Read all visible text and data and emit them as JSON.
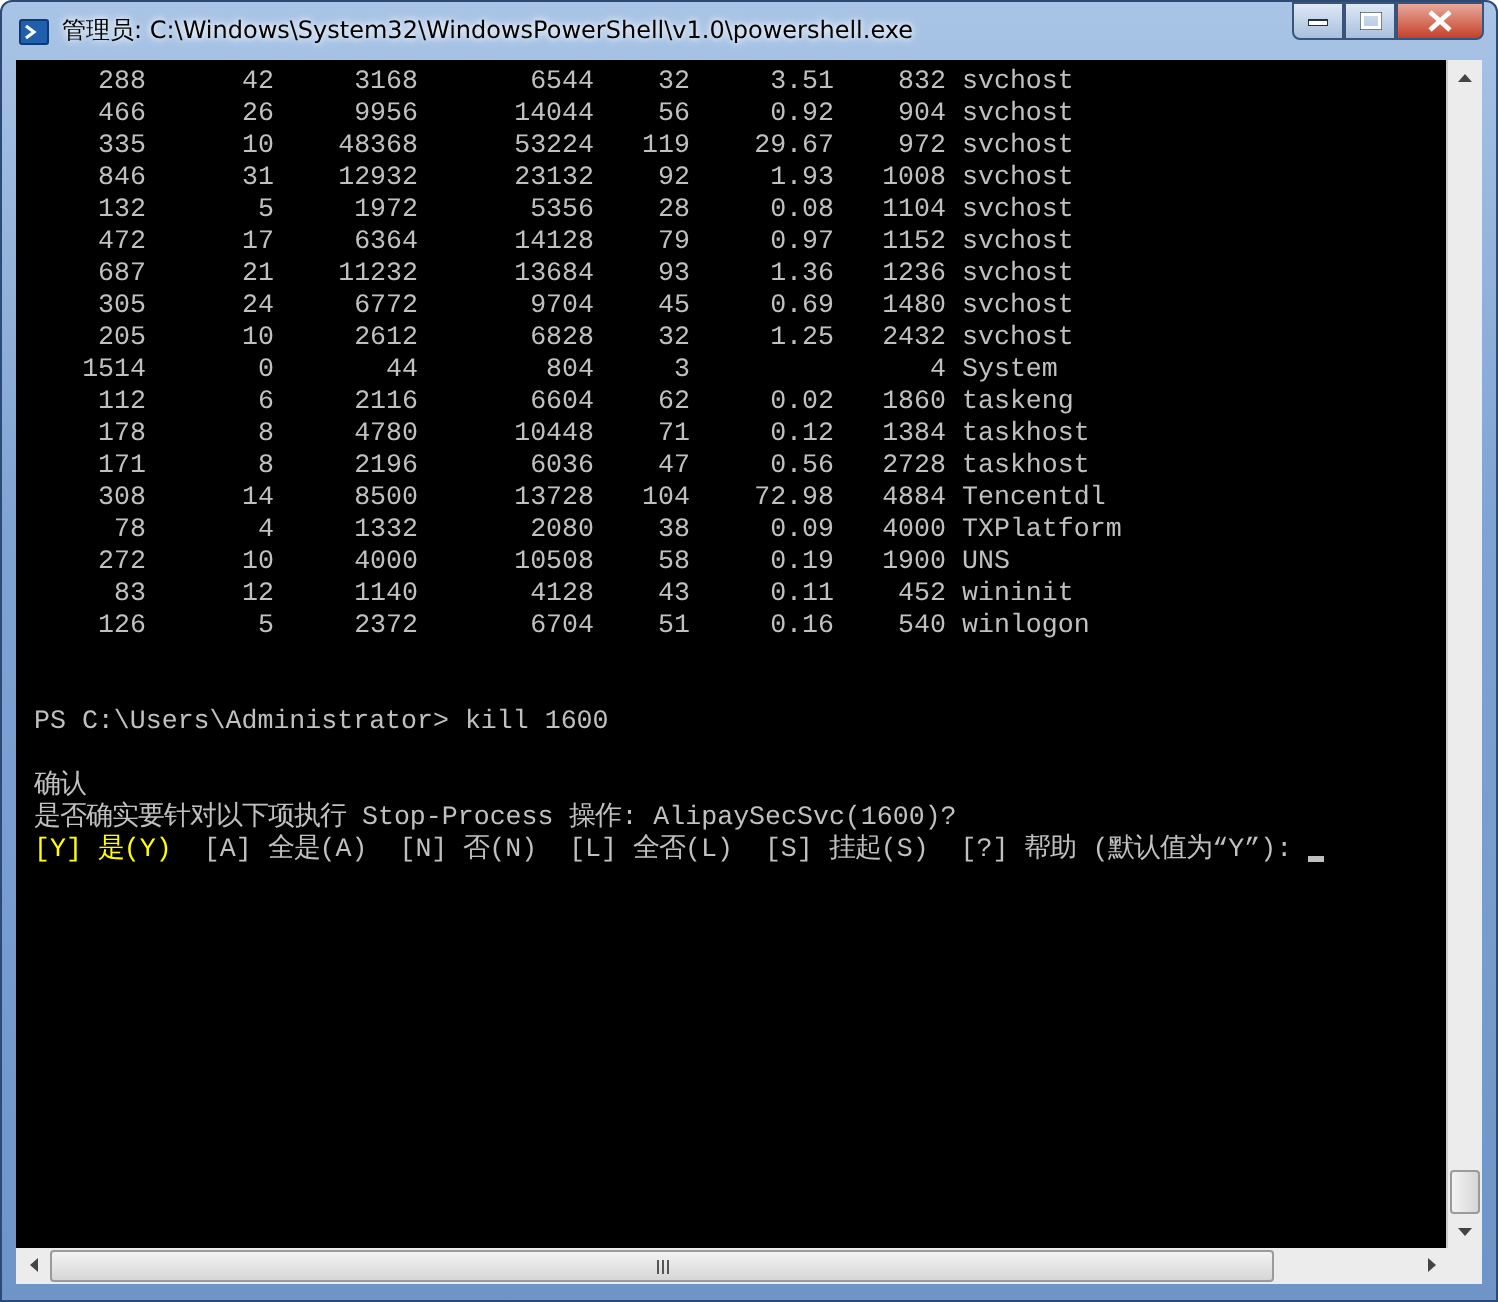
{
  "window": {
    "title": "管理员: C:\\Windows\\System32\\WindowsPowerShell\\v1.0\\powershell.exe"
  },
  "process_rows": [
    {
      "cells": [
        "288",
        "42",
        "3168",
        "6544",
        "32",
        "3.51",
        "832",
        "svchost"
      ]
    },
    {
      "cells": [
        "466",
        "26",
        "9956",
        "14044",
        "56",
        "0.92",
        "904",
        "svchost"
      ]
    },
    {
      "cells": [
        "335",
        "10",
        "48368",
        "53224",
        "119",
        "29.67",
        "972",
        "svchost"
      ]
    },
    {
      "cells": [
        "846",
        "31",
        "12932",
        "23132",
        "92",
        "1.93",
        "1008",
        "svchost"
      ]
    },
    {
      "cells": [
        "132",
        "5",
        "1972",
        "5356",
        "28",
        "0.08",
        "1104",
        "svchost"
      ]
    },
    {
      "cells": [
        "472",
        "17",
        "6364",
        "14128",
        "79",
        "0.97",
        "1152",
        "svchost"
      ]
    },
    {
      "cells": [
        "687",
        "21",
        "11232",
        "13684",
        "93",
        "1.36",
        "1236",
        "svchost"
      ]
    },
    {
      "cells": [
        "305",
        "24",
        "6772",
        "9704",
        "45",
        "0.69",
        "1480",
        "svchost"
      ]
    },
    {
      "cells": [
        "205",
        "10",
        "2612",
        "6828",
        "32",
        "1.25",
        "2432",
        "svchost"
      ]
    },
    {
      "cells": [
        "1514",
        "0",
        "44",
        "804",
        "3",
        null,
        "4",
        "System"
      ]
    },
    {
      "cells": [
        "112",
        "6",
        "2116",
        "6604",
        "62",
        "0.02",
        "1860",
        "taskeng"
      ]
    },
    {
      "cells": [
        "178",
        "8",
        "4780",
        "10448",
        "71",
        "0.12",
        "1384",
        "taskhost"
      ]
    },
    {
      "cells": [
        "171",
        "8",
        "2196",
        "6036",
        "47",
        "0.56",
        "2728",
        "taskhost"
      ]
    },
    {
      "cells": [
        "308",
        "14",
        "8500",
        "13728",
        "104",
        "72.98",
        "4884",
        "Tencentdl"
      ]
    },
    {
      "cells": [
        "78",
        "4",
        "1332",
        "2080",
        "38",
        "0.09",
        "4000",
        "TXPlatform"
      ]
    },
    {
      "cells": [
        "272",
        "10",
        "4000",
        "10508",
        "58",
        "0.19",
        "1900",
        "UNS"
      ]
    },
    {
      "cells": [
        "83",
        "12",
        "1140",
        "4128",
        "43",
        "0.11",
        "452",
        "wininit"
      ]
    },
    {
      "cells": [
        "126",
        "5",
        "2372",
        "6704",
        "51",
        "0.16",
        "540",
        "winlogon"
      ]
    }
  ],
  "console_lines": [
    {
      "kind": "prompt",
      "text": "PS C:\\Users\\Administrator> kill 1600"
    },
    {
      "kind": "heading",
      "text": "确认"
    },
    {
      "kind": "text",
      "text": "是否确实要针对以下项执行 Stop-Process 操作: AlipaySecSvc(1600)?"
    }
  ],
  "choices": [
    {
      "text": "[Y] 是(Y)",
      "selected": true
    },
    {
      "text": "[A] 全是(A)",
      "selected": false
    },
    {
      "text": "[N] 否(N)",
      "selected": false
    },
    {
      "text": "[L] 全否(L)",
      "selected": false
    },
    {
      "text": "[S] 挂起(S)",
      "selected": false
    },
    {
      "text": "[?] 帮助 (默认值为“Y”):",
      "selected": false
    }
  ]
}
